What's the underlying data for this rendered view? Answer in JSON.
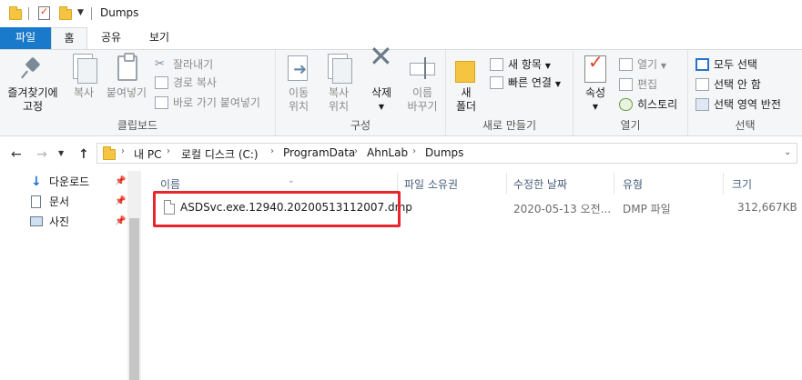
{
  "window": {
    "title": "Dumps"
  },
  "tabs": {
    "file": "파일",
    "home": "홈",
    "share": "공유",
    "view": "보기"
  },
  "ribbon": {
    "clipboard": {
      "label": "클립보드",
      "pin_line1": "즐겨찾기에",
      "pin_line2": "고정",
      "copy": "복사",
      "paste": "붙여넣기",
      "cut": "잘라내기",
      "copy_path": "경로 복사",
      "paste_shortcut": "바로 가기 붙여넣기"
    },
    "organize": {
      "label": "구성",
      "move_line1": "이동",
      "move_line2": "위치",
      "copy_line1": "복사",
      "copy_line2": "위치",
      "delete": "삭제",
      "rename_line1": "이름",
      "rename_line2": "바꾸기"
    },
    "new": {
      "label": "새로 만들기",
      "new_folder_line1": "새",
      "new_folder_line2": "폴더",
      "new_item": "새 항목",
      "easy_access": "빠른 연결"
    },
    "open": {
      "label": "열기",
      "properties": "속성",
      "open": "열기",
      "edit": "편집",
      "history": "히스토리"
    },
    "select": {
      "label": "선택",
      "select_all": "모두 선택",
      "select_none": "선택 안 함",
      "invert": "선택 영역 반전"
    }
  },
  "address": {
    "crumbs": [
      "내 PC",
      "로컬 디스크 (C:)",
      "ProgramData",
      "AhnLab",
      "Dumps"
    ]
  },
  "navpane": {
    "items": [
      {
        "label": "다운로드",
        "icon": "download-icon"
      },
      {
        "label": "문서",
        "icon": "document-icon"
      },
      {
        "label": "사진",
        "icon": "picture-icon"
      }
    ]
  },
  "list": {
    "columns": {
      "name": "이름",
      "owner": "파일 소유권",
      "modified": "수정한 날짜",
      "type": "유형",
      "size": "크기"
    },
    "rows": [
      {
        "name": "ASDSvc.exe.12940.20200513112007.dmp",
        "modified": "2020-05-13 오전...",
        "type": "DMP 파일",
        "size": "312,667KB"
      }
    ]
  },
  "colors": {
    "accent": "#1979ca",
    "highlight": "#e8262b"
  }
}
